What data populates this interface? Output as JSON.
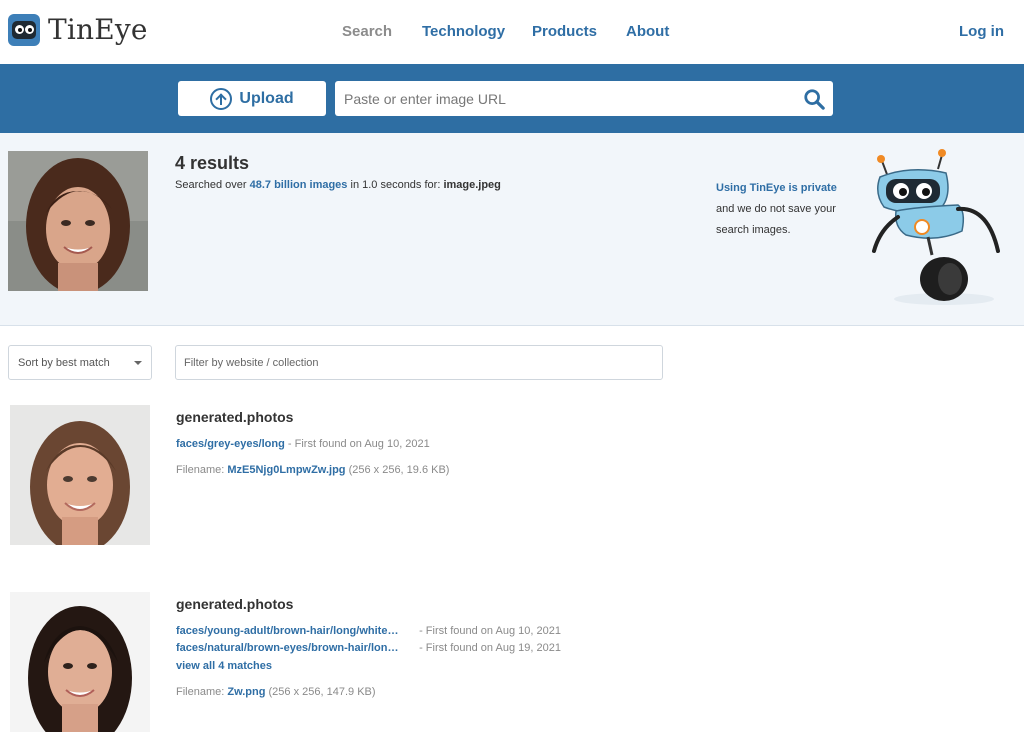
{
  "brand": {
    "name": "TinEye"
  },
  "nav": {
    "items": [
      {
        "label": "Search",
        "active": true
      },
      {
        "label": "Technology",
        "active": false
      },
      {
        "label": "Products",
        "active": false
      },
      {
        "label": "About",
        "active": false
      }
    ],
    "login": "Log in"
  },
  "search": {
    "upload_label": "Upload",
    "url_placeholder": "Paste or enter image URL"
  },
  "summary": {
    "results_count": "4 results",
    "searched_prefix": "Searched over ",
    "index_size": "48.7 billion images",
    "searched_middle": " in 1.0 seconds for: ",
    "filename": "image.jpeg",
    "privacy_link": "Using TinEye is private",
    "privacy_text": "and we do not save your search images."
  },
  "filters": {
    "sort_label": "Sort by best match",
    "filter_placeholder": "Filter by website / collection"
  },
  "results": [
    {
      "domain": "generated.photos",
      "matches": [
        {
          "path": "faces/grey-eyes/long",
          "found": "- First found on Aug 10, 2021"
        }
      ],
      "filename_label": "Filename: ",
      "filename": "MzE5Njg0LmpwZw.jpg",
      "meta": "(256 x 256, 19.6 KB)"
    },
    {
      "domain": "generated.photos",
      "matches": [
        {
          "path": "faces/young-adult/brown-hair/long/white…",
          "found": "- First found on Aug 10, 2021"
        },
        {
          "path": "faces/natural/brown-eyes/brown-hair/lon…",
          "found": "- First found on Aug 19, 2021"
        }
      ],
      "view_all": "view all 4 matches",
      "filename_label": "Filename: ",
      "filename": "Zw.png",
      "meta": "(256 x 256, 147.9 KB)"
    }
  ],
  "colors": {
    "accent": "#2f6ea5",
    "band": "#2e6ea3",
    "summary_bg": "#f2f6fa"
  }
}
